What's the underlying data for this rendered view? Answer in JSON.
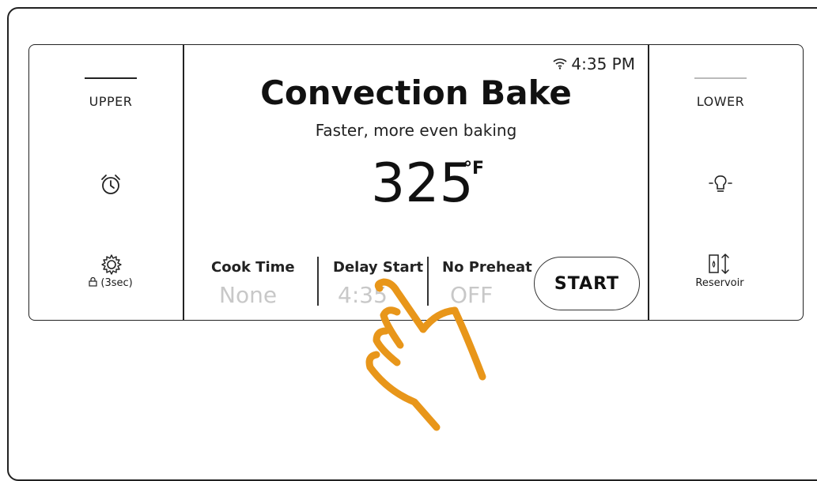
{
  "left_panel": {
    "upper_label": "UPPER",
    "alarm_icon": "alarm-clock-icon",
    "settings_icon": "gear-icon",
    "lock_label": "(3sec)"
  },
  "screen": {
    "wifi_icon": "wifi-icon",
    "time": "4:35 PM",
    "title": "Convection Bake",
    "subtitle": "Faster, more even baking",
    "temperature": "325",
    "unit": "°F",
    "options": [
      {
        "label": "Cook Time",
        "value": "None"
      },
      {
        "label": "Delay Start",
        "value": "4:35"
      },
      {
        "label": "No Preheat",
        "value": "OFF"
      }
    ],
    "start_label": "START"
  },
  "right_panel": {
    "lower_label": "LOWER",
    "light_icon": "oven-light-icon",
    "reservoir_icon": "reservoir-icon",
    "reservoir_label": "Reservoir"
  },
  "colors": {
    "hand": "#e8961a",
    "inactive_value": "#c8c8c8",
    "outline": "#222222"
  }
}
